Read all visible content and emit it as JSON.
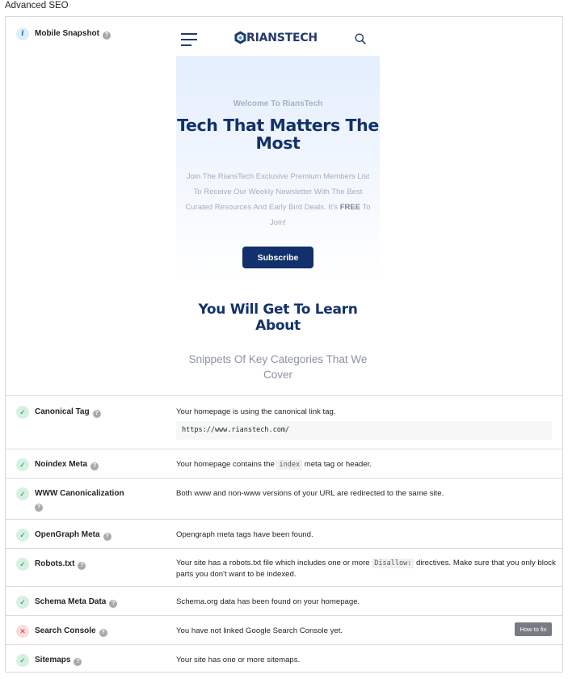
{
  "section_title": "Advanced SEO",
  "help_glyph": "?",
  "mobile_snapshot": {
    "label": "Mobile Snapshot",
    "status_icon": "info-icon",
    "preview": {
      "logo_text": "RIANSTECH",
      "kicker": "Welcome To RiansTech",
      "title": "Tech That Matters The Most",
      "text_before": "Join The RiansTech Exclusive Premium Members List To Receive Our Weekly Newsletter With The Best Curated Resources And Early Bird Deals. It's ",
      "text_bold": "FREE",
      "text_after": " To Join!",
      "subscribe_label": "Subscribe",
      "learn_title": "You Will Get To Learn About",
      "learn_sub": "Snippets Of Key Categories That We Cover"
    }
  },
  "checks": {
    "canonical": {
      "label": "Canonical Tag",
      "status": "pass",
      "message": "Your homepage is using the canonical link tag.",
      "code": "https://www.rianstech.com/"
    },
    "noindex": {
      "label": "Noindex Meta",
      "status": "pass",
      "message_before": "Your homepage contains the ",
      "code": "index",
      "message_after": " meta tag or header."
    },
    "www": {
      "label": "WWW Canonicalization",
      "status": "pass",
      "message": "Both www and non-www versions of your URL are redirected to the same site."
    },
    "opengraph": {
      "label": "OpenGraph Meta",
      "status": "pass",
      "message": "Opengraph meta tags have been found."
    },
    "robots": {
      "label": "Robots.txt",
      "status": "pass",
      "message_before": "Your site has a robots.txt file which includes one or more ",
      "code": "Disallow:",
      "message_after": " directives. Make sure that you only block parts you don't want to be indexed."
    },
    "schema": {
      "label": "Schema Meta Data",
      "status": "pass",
      "message": "Schema.org data has been found on your homepage."
    },
    "search_console": {
      "label": "Search Console",
      "status": "fail",
      "message": "You have not linked Google Search Console yet.",
      "button": "How to fix"
    },
    "sitemaps": {
      "label": "Sitemaps",
      "status": "pass",
      "message": "Your site has one or more sitemaps."
    }
  },
  "colors": {
    "pass": "#1e8e3e",
    "fail": "#d63638",
    "brand": "#13316b"
  }
}
